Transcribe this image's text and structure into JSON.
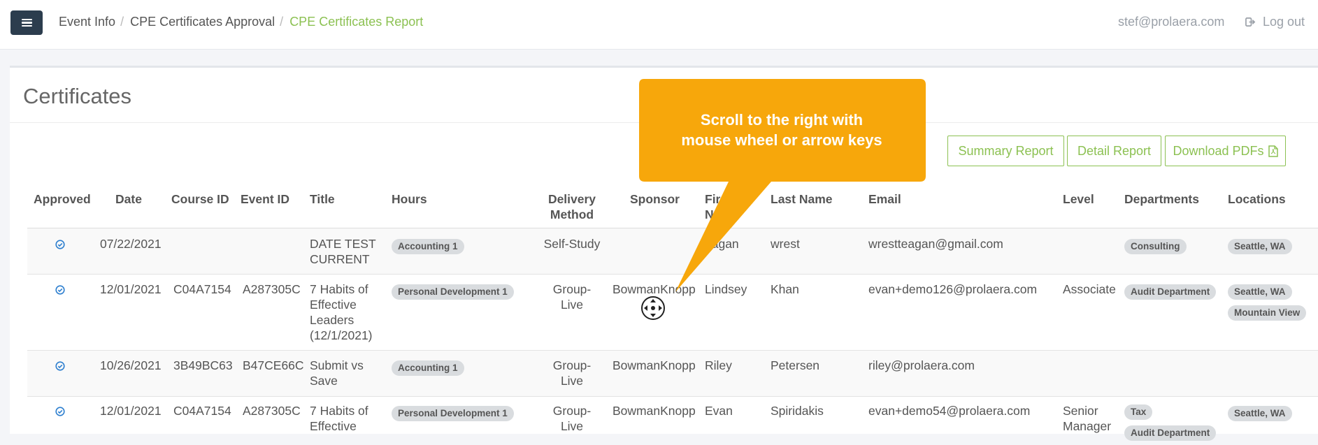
{
  "header": {
    "breadcrumbs": [
      "Event Info",
      "CPE Certificates Approval",
      "CPE Certificates Report"
    ],
    "separator": "/",
    "user_email": "stef@prolaera.com",
    "logout_label": "Log out"
  },
  "panel": {
    "title": "Certificates",
    "buttons": {
      "summary": "Summary Report",
      "detail": "Detail Report",
      "download": "Download PDFs"
    }
  },
  "table": {
    "headers": {
      "approved": "Approved",
      "date": "Date",
      "course_id": "Course ID",
      "event_id": "Event ID",
      "title": "Title",
      "hours": "Hours",
      "delivery_line1": "Delivery",
      "delivery_line2": "Method",
      "sponsor": "Sponsor",
      "first_name_line1": "Fir",
      "first_name_line2": "N",
      "last_name": "Last Name",
      "email": "Email",
      "level": "Level",
      "departments": "Departments",
      "locations": "Locations"
    },
    "rows": [
      {
        "date": "07/22/2021",
        "course_id": "",
        "event_id": "",
        "title": [
          "DATE TEST",
          "CURRENT"
        ],
        "hours": "Accounting 1",
        "delivery": [
          "Self-Study"
        ],
        "sponsor": "",
        "first_name": "eagan",
        "last_name": "wrest",
        "email": "wrestteagan@gmail.com",
        "level": [],
        "departments": [
          "Consulting"
        ],
        "locations": [
          "Seattle, WA"
        ]
      },
      {
        "date": "12/01/2021",
        "course_id": "C04A7154",
        "event_id": "A287305C",
        "title": [
          "7 Habits of",
          "Effective",
          "Leaders",
          "(12/1/2021)"
        ],
        "hours": "Personal Development 1",
        "delivery": [
          "Group-",
          "Live"
        ],
        "sponsor": "BowmanKnopp",
        "first_name": "Lindsey",
        "last_name": "Khan",
        "email": "evan+demo126@prolaera.com",
        "level": [
          "Associate"
        ],
        "departments": [
          "Audit Department"
        ],
        "locations": [
          "Seattle, WA",
          "Mountain View"
        ]
      },
      {
        "date": "10/26/2021",
        "course_id": "3B49BC63",
        "event_id": "B47CE66C",
        "title": [
          "Submit vs",
          "Save"
        ],
        "hours": "Accounting 1",
        "delivery": [
          "Group-",
          "Live"
        ],
        "sponsor": "BowmanKnopp",
        "first_name": "Riley",
        "last_name": "Petersen",
        "email": "riley@prolaera.com",
        "level": [],
        "departments": [],
        "locations": []
      },
      {
        "date": "12/01/2021",
        "course_id": "C04A7154",
        "event_id": "A287305C",
        "title": [
          "7 Habits of",
          "Effective"
        ],
        "hours": "Personal Development 1",
        "delivery": [
          "Group-",
          "Live"
        ],
        "sponsor": "BowmanKnopp",
        "first_name": "Evan",
        "last_name": "Spiridakis",
        "email": "evan+demo54@prolaera.com",
        "level": [
          "Senior",
          "Manager"
        ],
        "departments": [
          "Tax",
          "Audit Department"
        ],
        "locations": [
          "Seattle, WA"
        ]
      }
    ]
  },
  "callout": {
    "line1": "Scroll to the right with",
    "line2": "mouse wheel or arrow keys",
    "color": "#f7a70b"
  },
  "colors": {
    "accent": "#8cc152",
    "nav_button": "#2c3d4e",
    "check": "#2e7fcf"
  }
}
